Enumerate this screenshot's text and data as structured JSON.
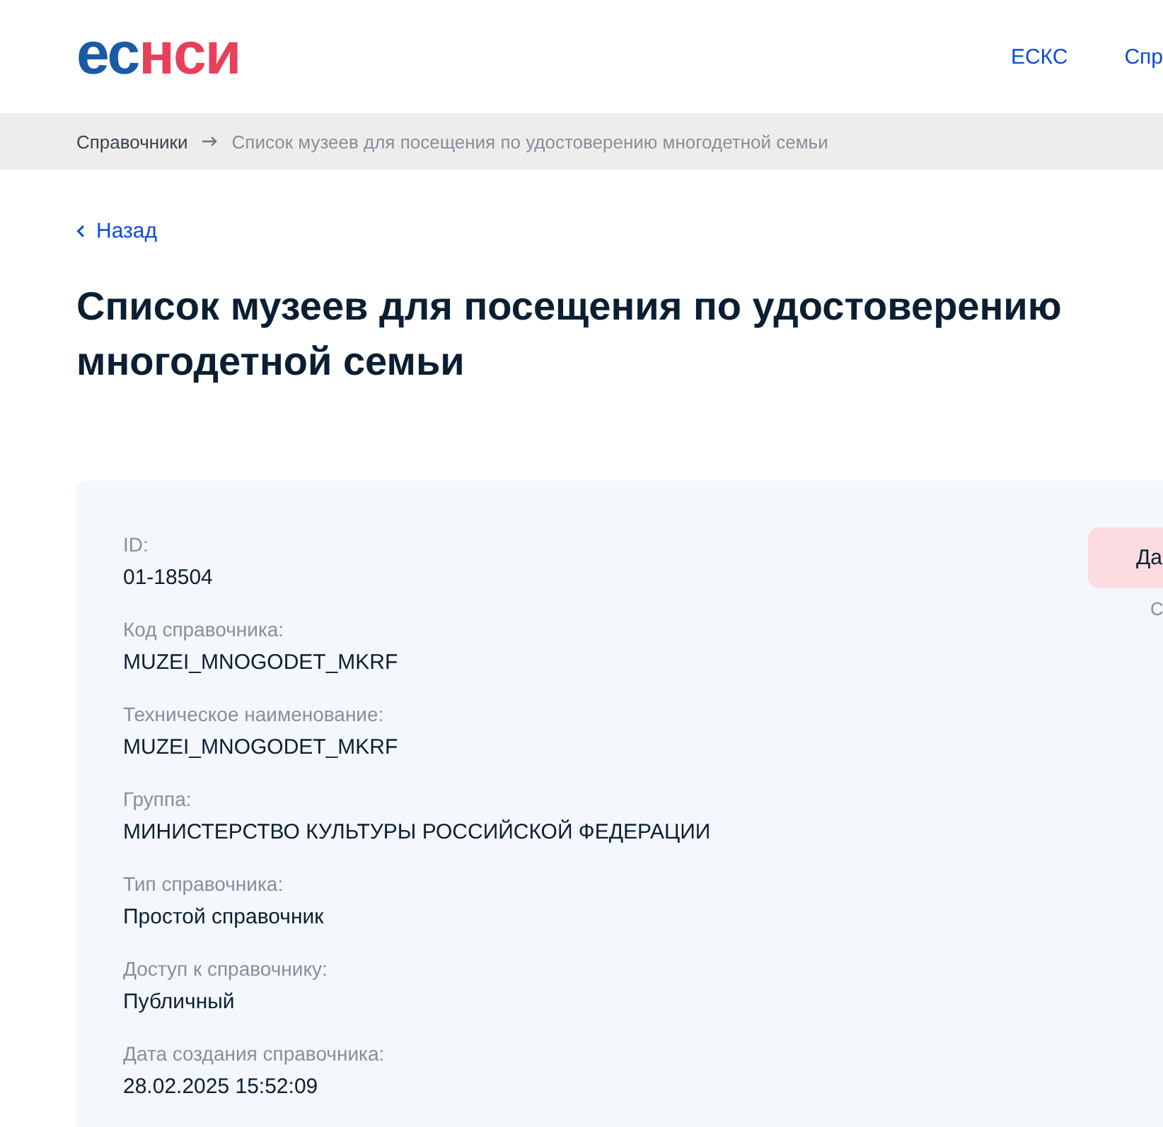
{
  "header": {
    "logo": {
      "prefix": "ес",
      "suffix": "нси"
    },
    "nav": [
      {
        "label": "ЕСКС"
      },
      {
        "label": "Спр"
      }
    ]
  },
  "breadcrumbs": [
    {
      "label": "Справочники",
      "current": false
    },
    {
      "label": "Список музеев для посещения по удостоверению многодетной семьи",
      "current": true
    }
  ],
  "back_link": {
    "label": "Назад"
  },
  "title": "Список музеев для посещения по удостоверению многодетной семьи",
  "card": {
    "fields": [
      {
        "label": "ID:",
        "value": "01-18504"
      },
      {
        "label": "Код справочника:",
        "value": "MUZEI_MNOGODET_MKRF"
      },
      {
        "label": "Техническое наименование:",
        "value": "MUZEI_MNOGODET_MKRF"
      },
      {
        "label": "Группа:",
        "value": "МИНИСТЕРСТВО КУЛЬТУРЫ РОССИЙСКОЙ ФЕДЕРАЦИИ"
      },
      {
        "label": "Тип справочника:",
        "value": "Простой справочник"
      },
      {
        "label": "Доступ к справочнику:",
        "value": "Публичный"
      },
      {
        "label": "Дата создания справочника:",
        "value": "28.02.2025 15:52:09"
      }
    ],
    "action_button": {
      "label": "Да"
    },
    "caption": "С"
  }
}
